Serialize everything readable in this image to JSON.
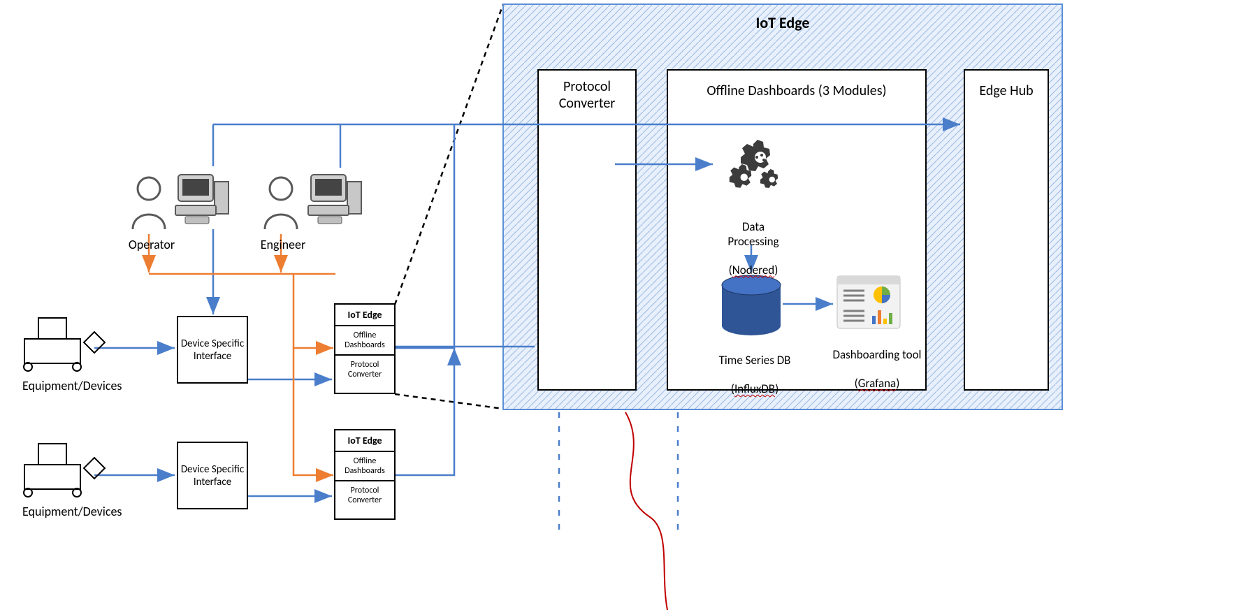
{
  "iot_edge": {
    "title": "IoT Edge",
    "protocol_converter": "Protocol\nConverter",
    "offline_dashboards": {
      "title": "Offline Dashboards (3 Modules)",
      "data_processing": {
        "label": "Data\nProcessing",
        "tech": "Nodered"
      },
      "tsdb": {
        "label": "Time Series DB",
        "tech": "InfluxDB"
      },
      "dashboard": {
        "label": "Dashboarding tool",
        "tech": "Grafana"
      }
    },
    "edge_hub": "Edge Hub"
  },
  "roles": {
    "operator": "Operator",
    "engineer": "Engineer"
  },
  "left": {
    "equipment": "Equipment/Devices",
    "dsi": "Device\nSpecific\nInterface",
    "small_edge": {
      "title": "IoT Edge",
      "offline": "Offline\nDashboards",
      "protocol": "Protocol\nConverter"
    }
  }
}
